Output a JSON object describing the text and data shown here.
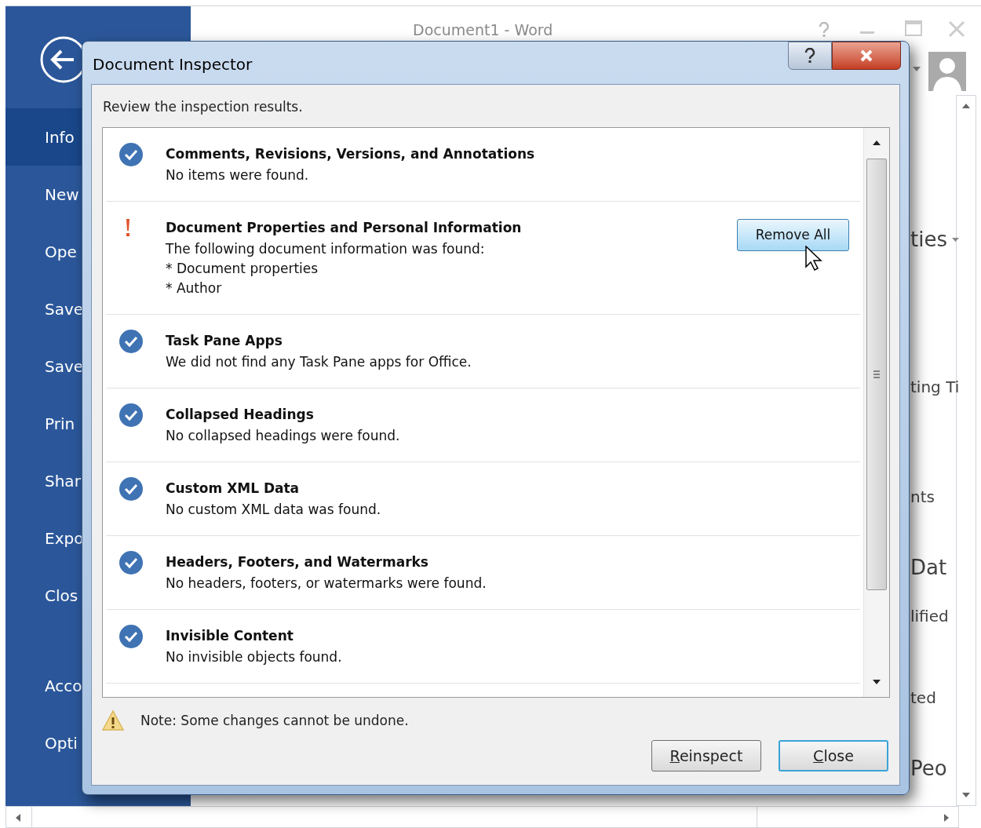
{
  "word_window": {
    "title": "Document1 - Word",
    "sidebar": {
      "items": [
        {
          "label": "Info",
          "selected": true
        },
        {
          "label": "New",
          "selected": false
        },
        {
          "label": "Ope",
          "selected": false
        },
        {
          "label": "Save",
          "selected": false
        },
        {
          "label": "Save",
          "selected": false
        },
        {
          "label": "Prin",
          "selected": false
        },
        {
          "label": "Shar",
          "selected": false
        },
        {
          "label": "Expo",
          "selected": false
        },
        {
          "label": "Clos",
          "selected": false
        },
        {
          "label": "Acco",
          "selected": false
        },
        {
          "label": "Opti",
          "selected": false
        }
      ]
    },
    "content_fragments": [
      {
        "kind": "heading",
        "text": "ties",
        "dropdown": true
      },
      {
        "kind": "label",
        "text": "ting Ti"
      },
      {
        "kind": "label",
        "text": "nts"
      },
      {
        "kind": "heading",
        "text": "Dat"
      },
      {
        "kind": "label",
        "text": "lified"
      },
      {
        "kind": "label",
        "text": "ted"
      },
      {
        "kind": "heading",
        "text": "Peo"
      }
    ]
  },
  "dialog": {
    "title": "Document Inspector",
    "instruction": "Review the inspection results.",
    "results": [
      {
        "kind": "clean",
        "title": "Comments, Revisions, Versions, and Annotations",
        "lines": [
          "No items were found."
        ]
      },
      {
        "kind": "found",
        "title": "Document Properties and Personal Information",
        "lines": [
          "The following document information was found:",
          "* Document properties",
          "* Author"
        ],
        "action": "Remove All"
      },
      {
        "kind": "clean",
        "title": "Task Pane Apps",
        "lines": [
          "We did not find any Task Pane apps for Office."
        ]
      },
      {
        "kind": "clean",
        "title": "Collapsed Headings",
        "lines": [
          "No collapsed headings were found."
        ]
      },
      {
        "kind": "clean",
        "title": "Custom XML Data",
        "lines": [
          "No custom XML data was found."
        ]
      },
      {
        "kind": "clean",
        "title": "Headers, Footers, and Watermarks",
        "lines": [
          "No headers, footers, or watermarks were found."
        ]
      },
      {
        "kind": "clean",
        "title": "Invisible Content",
        "lines": [
          "No invisible objects found."
        ]
      }
    ],
    "note": "Note: Some changes cannot be undone.",
    "buttons": [
      {
        "label": "Reinspect",
        "default": false
      },
      {
        "label": "Close",
        "default": true
      }
    ]
  }
}
